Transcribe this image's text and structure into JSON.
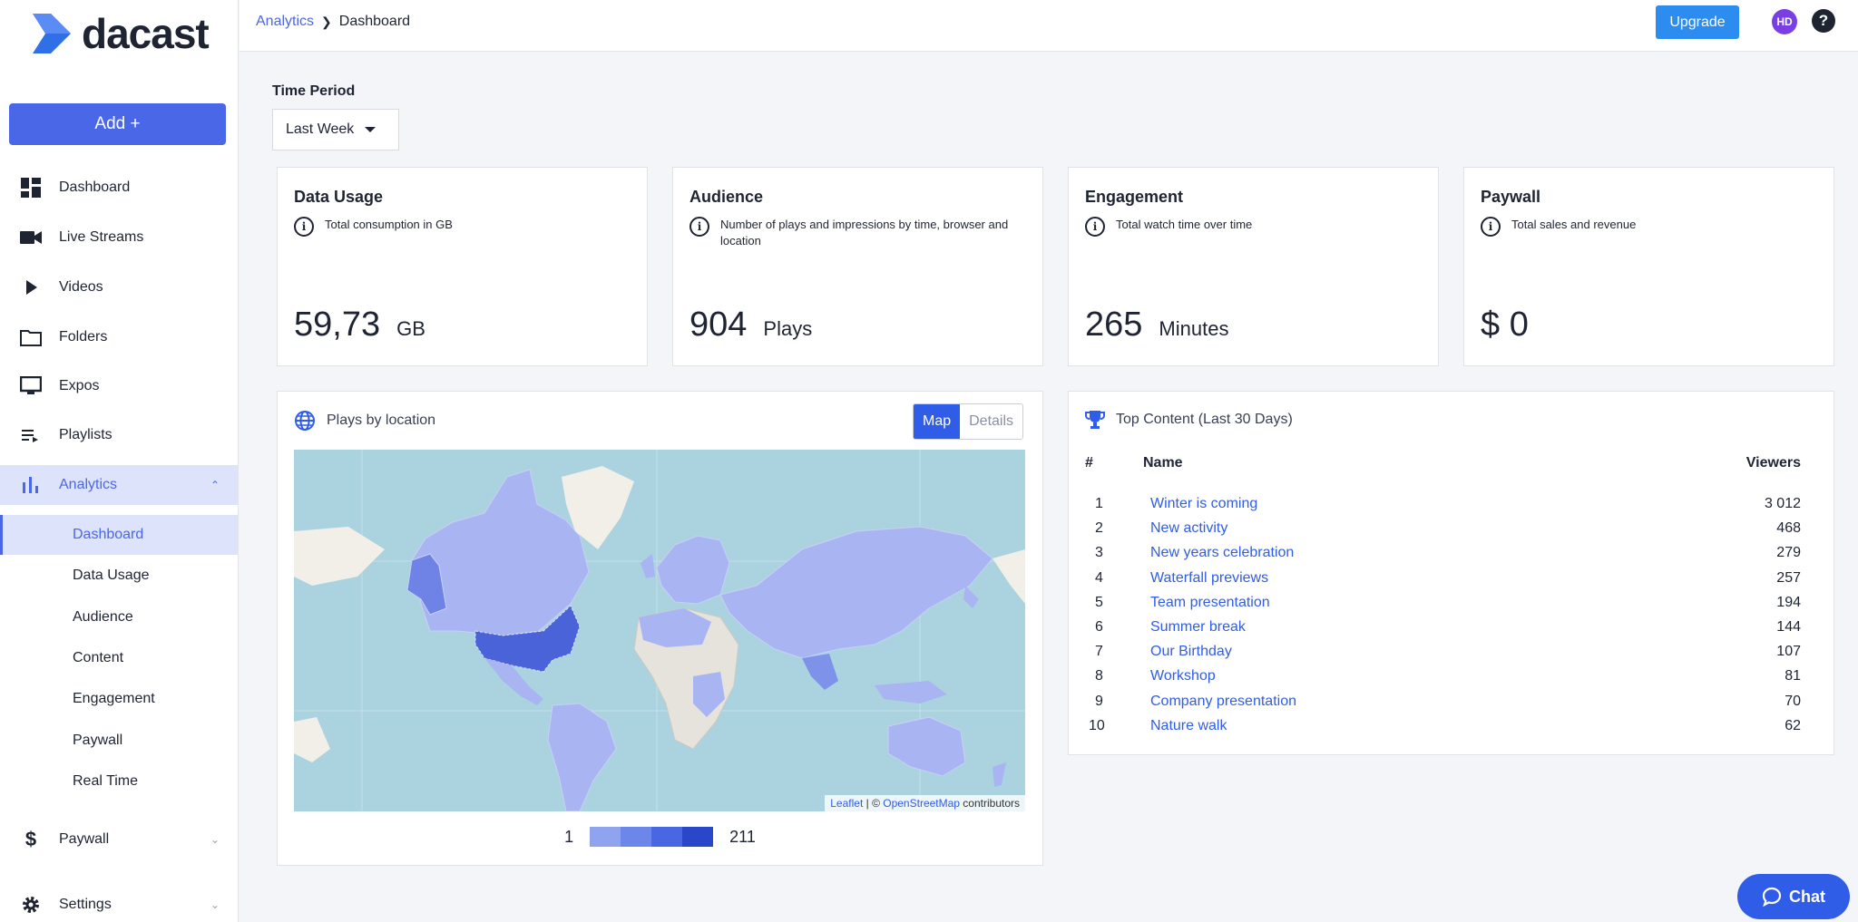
{
  "app": {
    "logo_text": "dacast",
    "brand_color": "#4a67e8"
  },
  "sidebar": {
    "add_label": "Add +",
    "items": [
      {
        "label": "Dashboard",
        "icon": "dashboard-icon"
      },
      {
        "label": "Live Streams",
        "icon": "video-camera-icon"
      },
      {
        "label": "Videos",
        "icon": "play-icon"
      },
      {
        "label": "Folders",
        "icon": "folder-icon"
      },
      {
        "label": "Expos",
        "icon": "monitor-icon"
      },
      {
        "label": "Playlists",
        "icon": "playlist-icon"
      },
      {
        "label": "Analytics",
        "icon": "bar-chart-icon"
      }
    ],
    "analytics_sub": [
      "Dashboard",
      "Data Usage",
      "Audience",
      "Content",
      "Engagement",
      "Paywall",
      "Real Time"
    ],
    "paywall_label": "Paywall",
    "settings_label": "Settings"
  },
  "topbar": {
    "breadcrumb_root": "Analytics",
    "breadcrumb_current": "Dashboard",
    "upgrade_label": "Upgrade",
    "avatar_initials": "HD",
    "help_label": "?"
  },
  "filters": {
    "time_period_label": "Time Period",
    "time_period_value": "Last Week"
  },
  "stats": {
    "data_usage": {
      "title": "Data Usage",
      "desc": "Total consumption in GB",
      "value": "59,73",
      "unit": "GB"
    },
    "audience": {
      "title": "Audience",
      "desc": "Number of plays and impressions by time, browser and location",
      "value": "904",
      "unit": "Plays"
    },
    "engagement": {
      "title": "Engagement",
      "desc": "Total watch time over time",
      "value": "265",
      "unit": "Minutes"
    },
    "paywall": {
      "title": "Paywall",
      "desc": "Total sales and revenue",
      "value": "$ 0",
      "unit": ""
    }
  },
  "map_panel": {
    "title": "Plays by location",
    "tab_map": "Map",
    "tab_details": "Details",
    "attrib_leaflet": "Leaflet",
    "attrib_sep": " | © ",
    "attrib_osm": "OpenStreetMap",
    "attrib_tail": " contributors",
    "legend_min": "1",
    "legend_max": "211",
    "legend_colors": [
      "#8fa3ef",
      "#6d86ea",
      "#4a67e3",
      "#2a46c9"
    ]
  },
  "top_content": {
    "title": "Top Content (Last 30 Days)",
    "col_num": "#",
    "col_name": "Name",
    "col_viewers": "Viewers",
    "rows": [
      {
        "n": "1",
        "name": "Winter is coming",
        "viewers": "3 012"
      },
      {
        "n": "2",
        "name": "New activity",
        "viewers": "468"
      },
      {
        "n": "3",
        "name": "New years celebration",
        "viewers": "279"
      },
      {
        "n": "4",
        "name": "Waterfall previews",
        "viewers": "257"
      },
      {
        "n": "5",
        "name": "Team presentation",
        "viewers": "194"
      },
      {
        "n": "6",
        "name": "Summer break",
        "viewers": "144"
      },
      {
        "n": "7",
        "name": "Our Birthday",
        "viewers": "107"
      },
      {
        "n": "8",
        "name": "Workshop",
        "viewers": "81"
      },
      {
        "n": "9",
        "name": "Company presentation",
        "viewers": "70"
      },
      {
        "n": "10",
        "name": "Nature walk",
        "viewers": "62"
      }
    ]
  },
  "chat": {
    "label": "Chat"
  }
}
